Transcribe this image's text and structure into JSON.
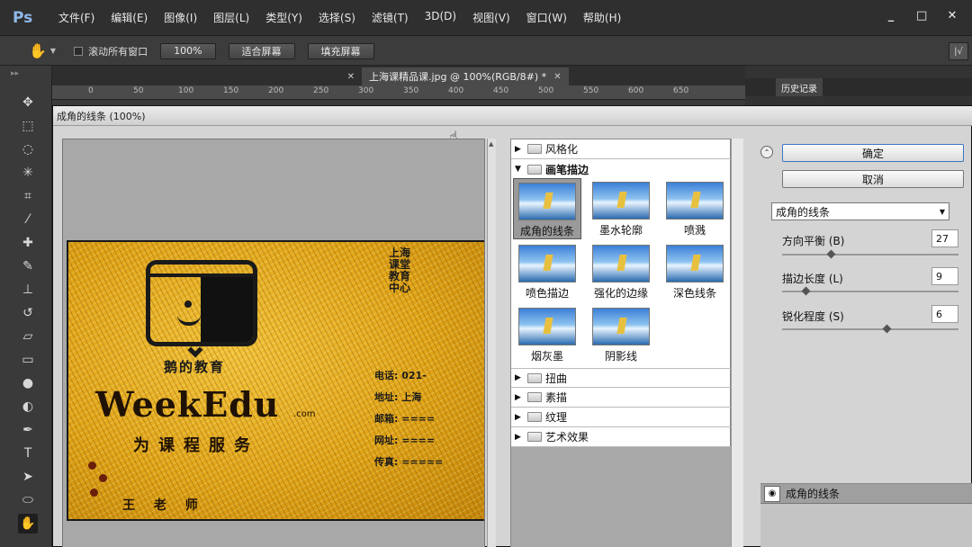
{
  "app": {
    "logo": "Ps"
  },
  "menubar": {
    "items": [
      "文件(F)",
      "编辑(E)",
      "图像(I)",
      "图层(L)",
      "类型(Y)",
      "选择(S)",
      "滤镜(T)",
      "3D(D)",
      "视图(V)",
      "窗口(W)",
      "帮助(H)"
    ],
    "min": "_",
    "max": "□",
    "close": "✕"
  },
  "optbar": {
    "check_label": "滚动所有窗口",
    "buttons": [
      "100%",
      "适合屏幕",
      "填充屏幕"
    ],
    "right_btn": "|√"
  },
  "tabs": [
    {
      "label": "",
      "active": false
    },
    {
      "label": "上海课精品课.jpg @ 100%(RGB/8#) *",
      "active": true
    }
  ],
  "ruler": {
    "ticks": [
      "0",
      "50",
      "100",
      "150",
      "200",
      "250",
      "300",
      "350",
      "400",
      "450",
      "500",
      "550",
      "600",
      "650"
    ]
  },
  "rightpanel": {
    "tabs": [
      "",
      "历史记录",
      "",
      ""
    ]
  },
  "dialog": {
    "title": "成角的线条 (100%)",
    "ok": "确定",
    "cancel": "取消",
    "selected_filter": "成角的线条",
    "params": [
      {
        "label": "方向平衡 (B)",
        "value": "27",
        "fraction": 0.27
      },
      {
        "label": "描边长度 (L)",
        "value": "9",
        "fraction": 0.12
      },
      {
        "label": "锐化程度 (S)",
        "value": "6",
        "fraction": 0.6
      }
    ],
    "effect_layer": "成角的线条"
  },
  "gallery": {
    "cat_top": "风格化",
    "cat_expanded": "画笔描边",
    "thumbs": [
      "成角的线条",
      "墨水轮廓",
      "喷溅",
      "喷色描边",
      "强化的边缘",
      "深色线条",
      "烟灰墨",
      "阴影线"
    ],
    "cats_bottom": [
      "扭曲",
      "素描",
      "纹理",
      "艺术效果"
    ]
  },
  "card": {
    "logo_label": "鹅的教育",
    "brand": "WeekEdu",
    "brand_small": ".com",
    "slogan": "为课程服务",
    "footer": "王 老 师",
    "vertical": "上海课堂教育中心",
    "contact": [
      "电话: 021-",
      "地址: 上海",
      "邮箱: ====",
      "网址: ====",
      "传真: ====="
    ]
  }
}
